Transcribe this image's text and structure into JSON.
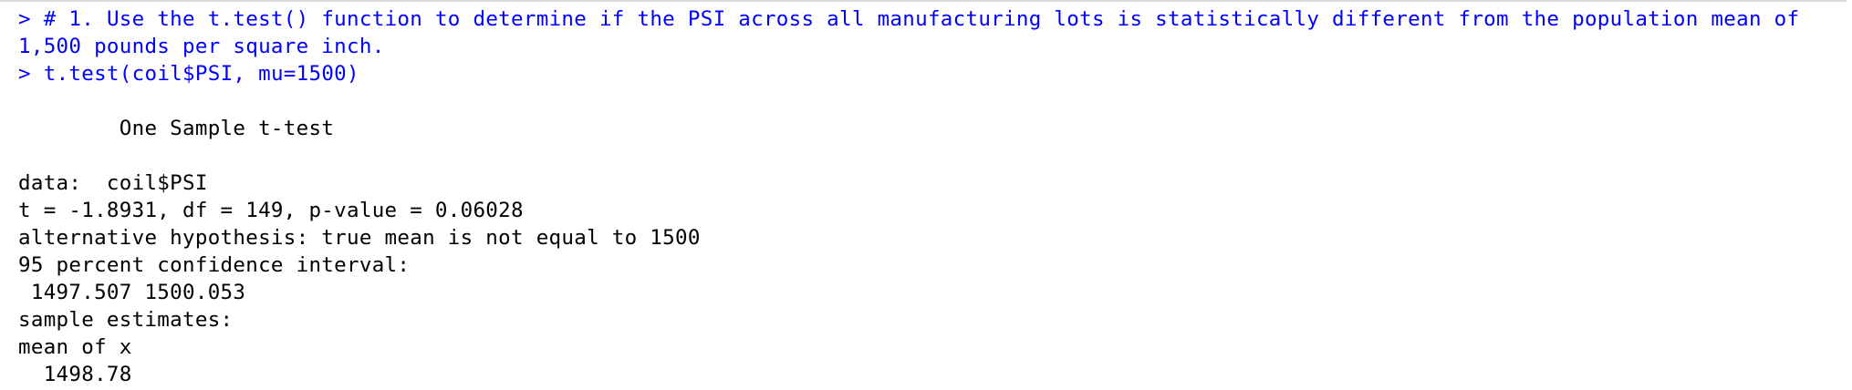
{
  "colors": {
    "input": "#0000ff",
    "output": "#000000",
    "background": "#ffffff"
  },
  "console": {
    "prompt": ">",
    "comment_line": "# 1. Use the t.test() function to determine if the PSI across all manufacturing lots is statistically different from the population mean of 1,500 pounds per square inch.",
    "command_line": "t.test(coil$PSI, mu=1500)",
    "output": {
      "test_title": "One Sample t-test",
      "data_label": "data:  coil$PSI",
      "statistics": "t = -1.8931, df = 149, p-value = 0.06028",
      "alternative": "alternative hypothesis: true mean is not equal to 1500",
      "ci_label": "95 percent confidence interval:",
      "ci_values": " 1497.507 1500.053",
      "estimates_label": "sample estimates:",
      "estimate_name": "mean of x",
      "estimate_value": "  1498.78"
    }
  }
}
